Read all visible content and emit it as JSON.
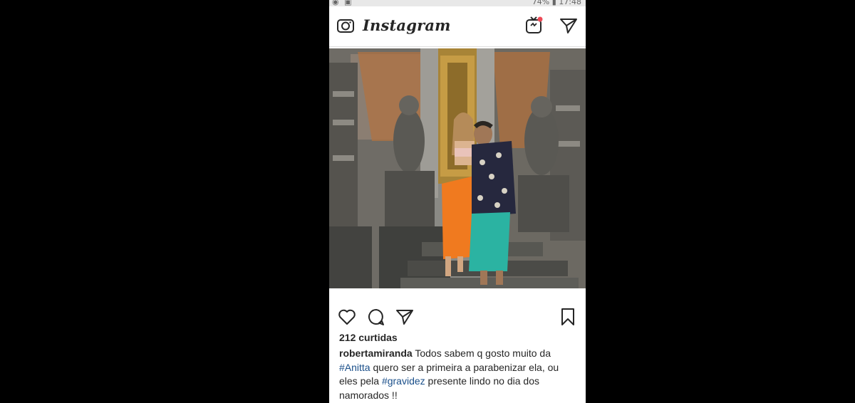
{
  "status_bar": {
    "left_icons": "◉ ▣",
    "battery": "74%",
    "time": "17:48"
  },
  "header": {
    "app_name": "Instagram",
    "camera_icon": "camera-icon",
    "igtv_icon": "igtv-icon",
    "direct_icon": "paper-plane-icon"
  },
  "post": {
    "image_icon": "photo",
    "actions": {
      "like": "heart-icon",
      "comment": "comment-icon",
      "share": "paper-plane-icon",
      "save": "bookmark-icon"
    },
    "likes": "212 curtidas",
    "caption": {
      "username": "robertamiranda",
      "text_1": " Todos sabem q gosto muito da ",
      "hashtag_1": "#Anitta",
      "text_2": " quero ser a primeira a parabenizar ela, ou eles pela ",
      "hashtag_2": "#gravidez",
      "text_3": " presente lindo no dia dos namorados !!"
    }
  },
  "colors": {
    "background": "#000000",
    "text": "#262626",
    "hashtag": "#1a4f8a",
    "notification": "#ed4956"
  }
}
